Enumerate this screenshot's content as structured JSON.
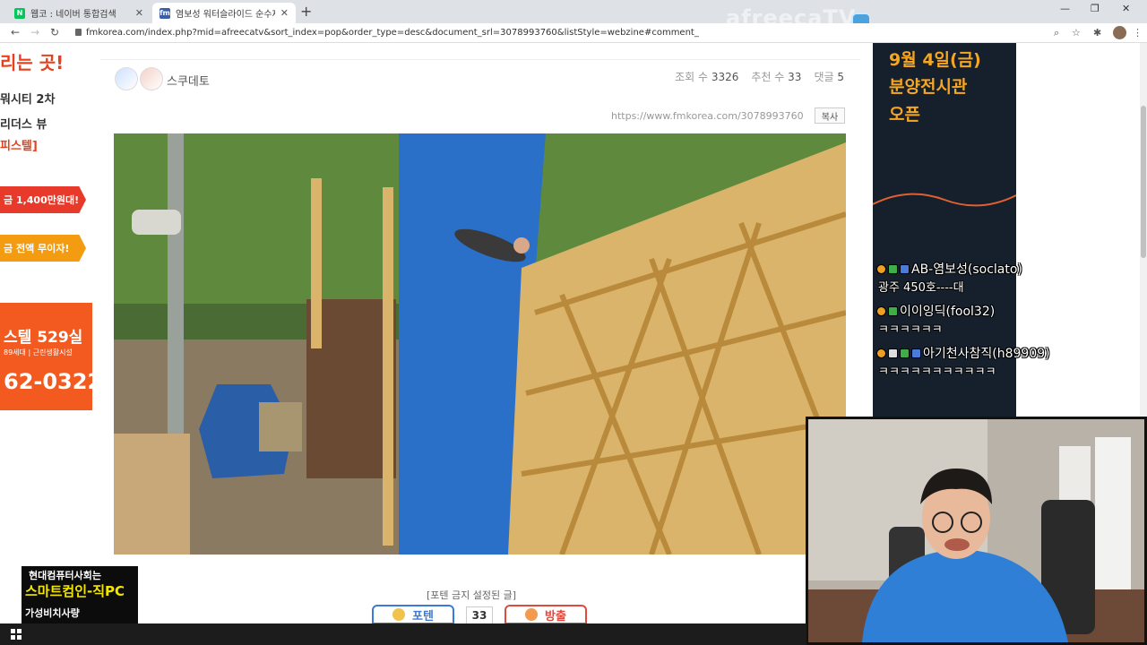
{
  "browser": {
    "tabs": [
      {
        "label": "웹코 : 네이버 통합검색",
        "favicon": "N"
      },
      {
        "label": "염보성 워터슬라이드 순수재미",
        "favicon": "fm"
      }
    ],
    "url": "fmkorea.com/index.php?mid=afreecatv&sort_index=pop&order_type=desc&document_srl=3078993760&listStyle=webzine#comment_"
  },
  "overlay": {
    "watermark": "afreecaTV"
  },
  "left_ad": {
    "line1": "리는 곳!",
    "line2": "뭐시티 2차",
    "line3": "리더스 뷰",
    "line4": "피스텔]",
    "tag_red": "금 1,400만원대!",
    "tag_orange": "금 전액 무이자!",
    "big_line1": "스텔 529실",
    "big_line2": "89세대 | 근린생활시설",
    "big_phone": "62-0322"
  },
  "post": {
    "author": "스쿠데토",
    "views_label": "조회 수",
    "views": "3326",
    "recommend_label": "추천 수",
    "recommend": "33",
    "comments_label": "댓글",
    "comments": "5",
    "permalink": "https://www.fmkorea.com/3078993760",
    "copy_label": "복사",
    "image_watermark": "afree",
    "restriction": "[포텐 금지 설정된 글]",
    "vote_up": "포텐",
    "vote_count": "33",
    "vote_down": "방출"
  },
  "right_ad": {
    "line1": "9월 4일(금)",
    "line2": "분양전시관",
    "line3": "오픈"
  },
  "chat": [
    {
      "user": "AB-염보성(soclato)",
      "message": "광주 450호----대"
    },
    {
      "user": "이이잉딕(fool32)",
      "message": "ㅋㅋㅋㅋㅋㅋ"
    },
    {
      "user": "아기천사참직(h89909)",
      "message": "ㅋㅋㅋㅋㅋㅋㅋㅋㅋㅋㅋ"
    }
  ],
  "promo": {
    "line1": "현대컴퓨터사회는",
    "line2": "스마트컴인-직PC",
    "line3": "가성비치사량"
  }
}
